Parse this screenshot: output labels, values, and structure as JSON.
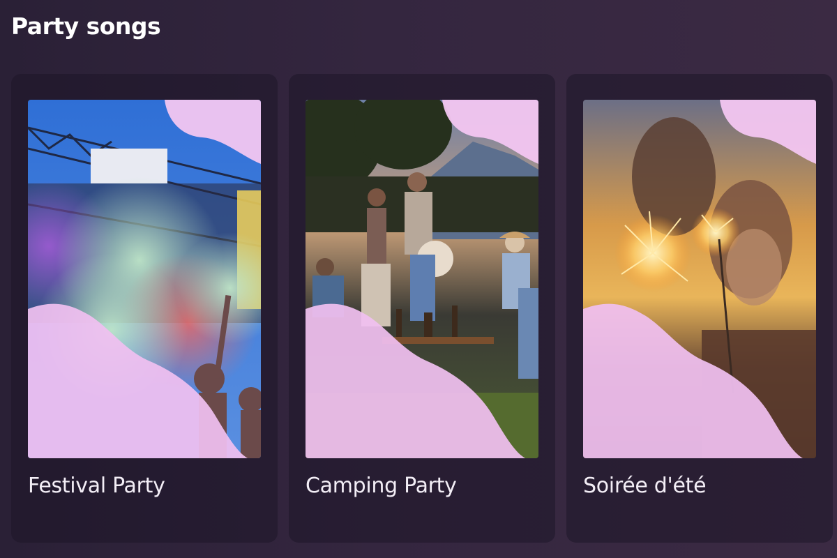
{
  "section": {
    "title": "Party songs"
  },
  "playlists": [
    {
      "title": "Festival Party",
      "image": "festival-crowd-color-powder-photo"
    },
    {
      "title": "Camping Party",
      "image": "camping-friends-outdoor-photo"
    },
    {
      "title": "Soirée d'été",
      "image": "couple-sparklers-sunset-photo"
    }
  ],
  "colors": {
    "background": "#2e2239",
    "card": "#2a1e33",
    "wave": "#f0bff0",
    "text": "#ffffff"
  }
}
